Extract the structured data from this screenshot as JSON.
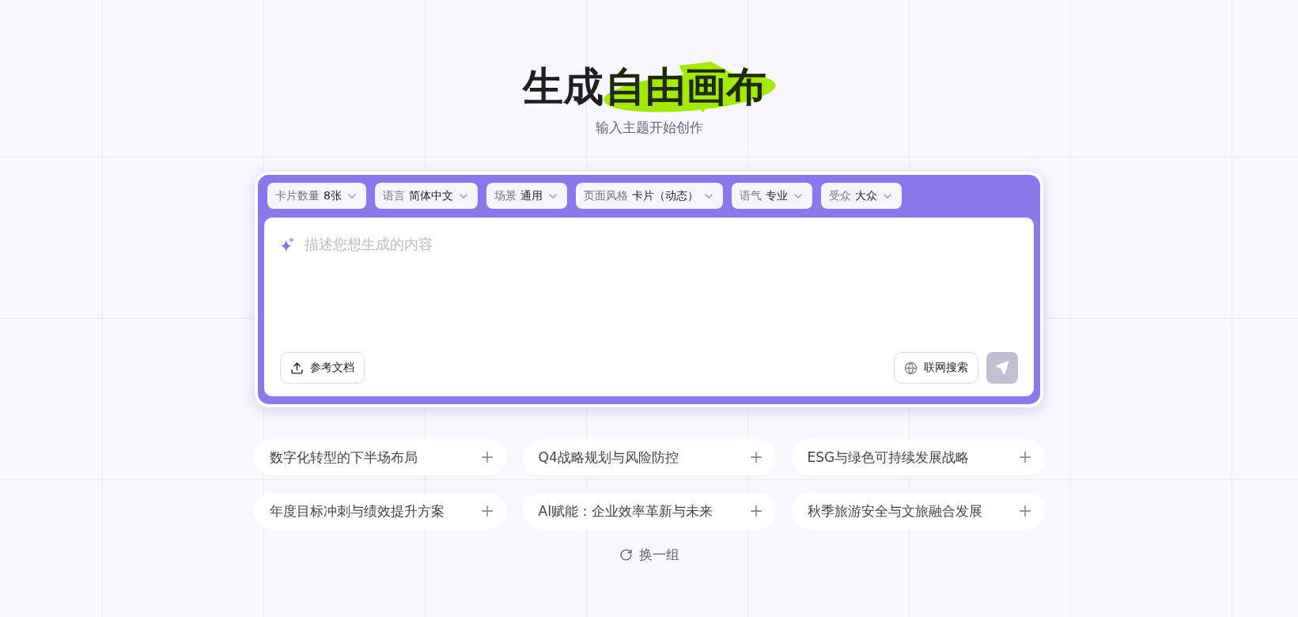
{
  "hero": {
    "title_plain": "生成",
    "title_highlight": "自由画布",
    "subtitle": "输入主题开始创作"
  },
  "options": [
    {
      "label": "卡片数量",
      "value": "8张"
    },
    {
      "label": "语言",
      "value": "简体中文"
    },
    {
      "label": "场景",
      "value": "通用"
    },
    {
      "label": "页面风格",
      "value": "卡片（动态）"
    },
    {
      "label": "语气",
      "value": "专业"
    },
    {
      "label": "受众",
      "value": "大众"
    }
  ],
  "prompt": {
    "placeholder": "描述您想生成的内容"
  },
  "actions": {
    "upload": "参考文档",
    "web_search": "联网搜索",
    "send_disabled": true
  },
  "suggestions": [
    "数字化转型的下半场布局",
    "Q4战略规划与风险防控",
    "ESG与绿色可持续发展战略",
    "年度目标冲刺与绩效提升方案",
    "AI赋能：企业效率革新与未来",
    "秋季旅游安全与文旅融合发展"
  ],
  "refresh": "换一组"
}
